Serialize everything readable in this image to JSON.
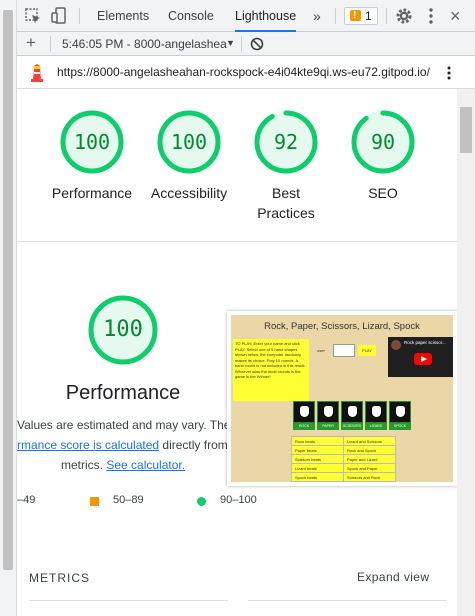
{
  "devtools": {
    "tabs": [
      "Elements",
      "Console",
      "Lighthouse"
    ],
    "active_tab": "Lighthouse",
    "more_tabs_glyph": "»",
    "issues_count": "1",
    "close_glyph": "×",
    "icons": [
      "select-element-icon",
      "device-toggle-icon",
      "more-tabs-icon",
      "warning-icon",
      "gear-icon",
      "kebab-menu-icon",
      "close-icon"
    ]
  },
  "toolbar": {
    "add_glyph": "+",
    "report_label": "5:46:05 PM - 8000-angelashea",
    "dropdown_glyph": "▼"
  },
  "urlbar": {
    "url": "https://8000-angelasheahan-rockspock-e4i04kte9qi.ws-eu72.gitpod.io/",
    "icons": [
      "lighthouse-logo-icon",
      "kebab-menu-icon"
    ]
  },
  "scores": [
    {
      "label_lines": [
        "Performance"
      ],
      "value": "100",
      "fraction": 1.0
    },
    {
      "label_lines": [
        "Accessibility"
      ],
      "value": "100",
      "fraction": 1.0
    },
    {
      "label_lines": [
        "Best",
        "Practices"
      ],
      "value": "92",
      "fraction": 0.92
    },
    {
      "label_lines": [
        "SEO"
      ],
      "value": "90",
      "fraction": 0.9
    }
  ],
  "performance": {
    "score": "100",
    "title": "Performance",
    "note_line1": "Values are estimated and may vary. The",
    "note_link": "rmance score is calculated",
    "note_line2_rest": "directly from t",
    "note_line3_prefix": "metrics.",
    "calculator_link": "See calculator."
  },
  "legend": {
    "fail": "–49",
    "average": "50–89",
    "pass": "90–100"
  },
  "screenshot": {
    "title": "Rock, Paper, Scissors, Lizard, Spock",
    "instructions": "TO PLAY: Enter your name and click PLAY. Select one of 5 hand shapes shown below. the computer randomly makes its choice. Play 10 rounds. A hand round is not included in this result. Whoever wins the most rounds is the game is the Winner!",
    "user_label": "user",
    "play_label": "PLAY",
    "video_title": "Rock paper scissor...",
    "video_avatar": "M",
    "hands": [
      "ROCK",
      "PAPER",
      "SCISSORS",
      "LIZARD",
      "SPOCK"
    ],
    "rules": [
      [
        "Rock beats",
        "Lizard and Scissors"
      ],
      [
        "Paper beats",
        "Rock and Spock"
      ],
      [
        "Scissors beats",
        "Paper and Lizard"
      ],
      [
        "Lizard beats",
        "Spock and Paper"
      ],
      [
        "Spock beats",
        "Scissors and Rock"
      ]
    ]
  },
  "metrics": {
    "heading": "METRICS",
    "expand_label": "Expand view"
  },
  "colors": {
    "pass": "#0cce6b",
    "pass_text": "#008a2e",
    "average": "#f29900",
    "link": "#1a73e8",
    "devtools_bg": "#f1f3f4"
  }
}
